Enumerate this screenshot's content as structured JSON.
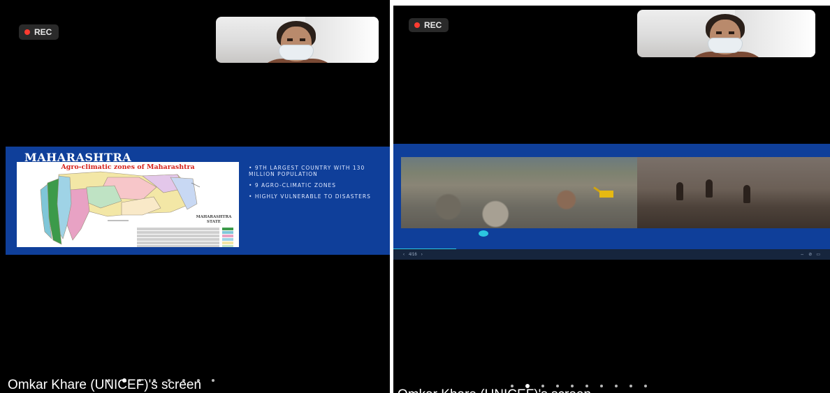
{
  "left_panel": {
    "rec_label": "REC",
    "slide": {
      "title": "MAHARASHTRA",
      "map_heading": "Agro-climatic zones of Maharashtra",
      "map_state_label": "MAHARASHTRA STATE",
      "bullets": [
        "9TH LARGEST COUNTRY WITH 130 MILLION POPULATION",
        "9 AGRO-CLIMATIC ZONES",
        "HIGHLY VULNERABLE TO DISASTERS"
      ]
    },
    "caption": "Omkar Khare (UNICEF)'s screen"
  },
  "right_panel": {
    "rec_label": "REC",
    "slide_toolbar": {
      "prev_icon": "‹",
      "page_label": "4/16",
      "next_icon": "›"
    },
    "caption": "Omkar Khare (UNICEF)'s screen"
  },
  "colors": {
    "slide_background": "#0f3f9a",
    "rec_dot": "#ff3b30",
    "accent": "#2bc7e0"
  },
  "pager": {
    "left_total": 8,
    "left_active_index": 1,
    "right_total": 10,
    "right_active_index": 1
  }
}
